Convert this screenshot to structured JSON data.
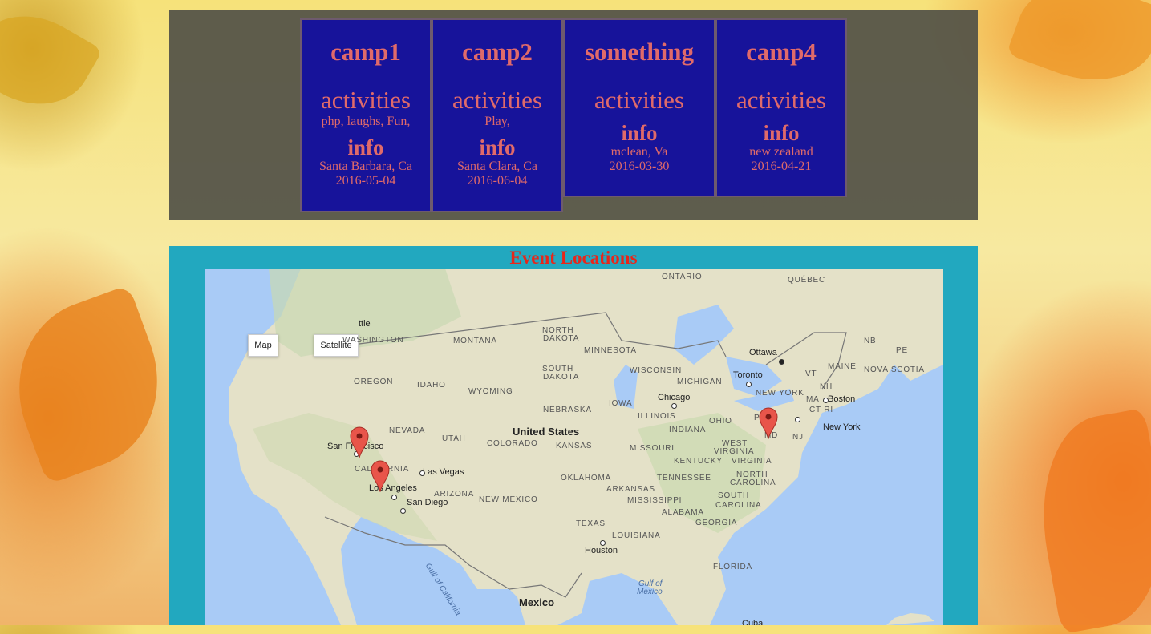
{
  "camps": [
    {
      "name": "camp1",
      "activities_label": "activities",
      "activities": "php, laughs, Fun,",
      "info_label": "info",
      "location": "Santa Barbara, Ca",
      "date": "2016-05-04"
    },
    {
      "name": "camp2",
      "activities_label": "activities",
      "activities": "Play,",
      "info_label": "info",
      "location": "Santa Clara, Ca",
      "date": "2016-06-04"
    },
    {
      "name": "something",
      "activities_label": "activities",
      "activities": "",
      "info_label": "info",
      "location": "mclean, Va",
      "date": "2016-03-30"
    },
    {
      "name": "camp4",
      "activities_label": "activities",
      "activities": "",
      "info_label": "info",
      "location": "new zealand",
      "date": "2016-04-21"
    }
  ],
  "map_section": {
    "title": "Event Locations",
    "map_button": "Map",
    "satellite_button": "Satellite",
    "labels": {
      "ontario": "ONTARIO",
      "quebec": "QUÉBEC",
      "washington": "WASHINGTON",
      "montana": "MONTANA",
      "north_dakota_1": "NORTH",
      "north_dakota_2": "DAKOTA",
      "minnesota": "MINNESOTA",
      "ottawa": "Ottawa",
      "nb": "NB",
      "pe": "PE",
      "south_dakota_1": "SOUTH",
      "south_dakota_2": "DAKOTA",
      "wisconsin": "WISCONSIN",
      "toronto": "Toronto",
      "maine": "MAINE",
      "nova_scotia": "NOVA SCOTIA",
      "vt": "VT",
      "oregon": "OREGON",
      "idaho": "IDAHO",
      "wyoming": "WYOMING",
      "michigan": "MICHIGAN",
      "new_york_state": "NEW YORK",
      "nh": "NH",
      "ma": "MA",
      "boston": "Boston",
      "chicago": "Chicago",
      "ct_ri": "CT RI",
      "nebraska": "NEBRASKA",
      "iowa": "IOWA",
      "pa": "P",
      "nevada": "NEVADA",
      "united_states": "United States",
      "illinois": "ILLINOIS",
      "ohio": "OHIO",
      "nj": "NJ",
      "new_york_city": "New York",
      "md": "MD",
      "san_francisco": "San Francisco",
      "utah": "UTAH",
      "colorado": "COLORADO",
      "kansas": "KANSAS",
      "missouri": "MISSOURI",
      "indiana": "INDIANA",
      "west_1": "WEST",
      "virginia_w": "VIRGINIA",
      "kentucky": "KENTUCKY",
      "virginia": "VIRGINIA",
      "california": "CAL",
      "california_2": "RNIA",
      "las_vegas": "Las Vegas",
      "los_angeles": "Los Angeles",
      "arizona": "ARIZONA",
      "oklahoma": "OKLAHOMA",
      "tennessee": "TENNESSEE",
      "north_carolina_1": "NORTH",
      "north_carolina_2": "CAROLINA",
      "san_diego": "San Diego",
      "new_mexico": "NEW MEXICO",
      "arkansas": "ARKANSAS",
      "mississippi": "MISSISSIPPI",
      "alabama": "ALABAMA",
      "south_carolina_1": "SOUTH",
      "south_carolina_2": "CAROLINA",
      "texas": "TEXAS",
      "georgia": "GEORGIA",
      "louisiana": "LOUISIANA",
      "gulf_of_california": "Gulf of California",
      "houston": "Houston",
      "florida": "FLORIDA",
      "gulf_of_mexico_1": "Gulf of",
      "gulf_of_mexico_2": "Mexico",
      "mexico": "Mexico",
      "cuba": "Cuba",
      "seattle": "ttle"
    }
  },
  "colors": {
    "card_bg": "#17139a",
    "card_text": "#e06a6a",
    "title_red": "#e8261a",
    "map_frame": "#22a8bf"
  }
}
